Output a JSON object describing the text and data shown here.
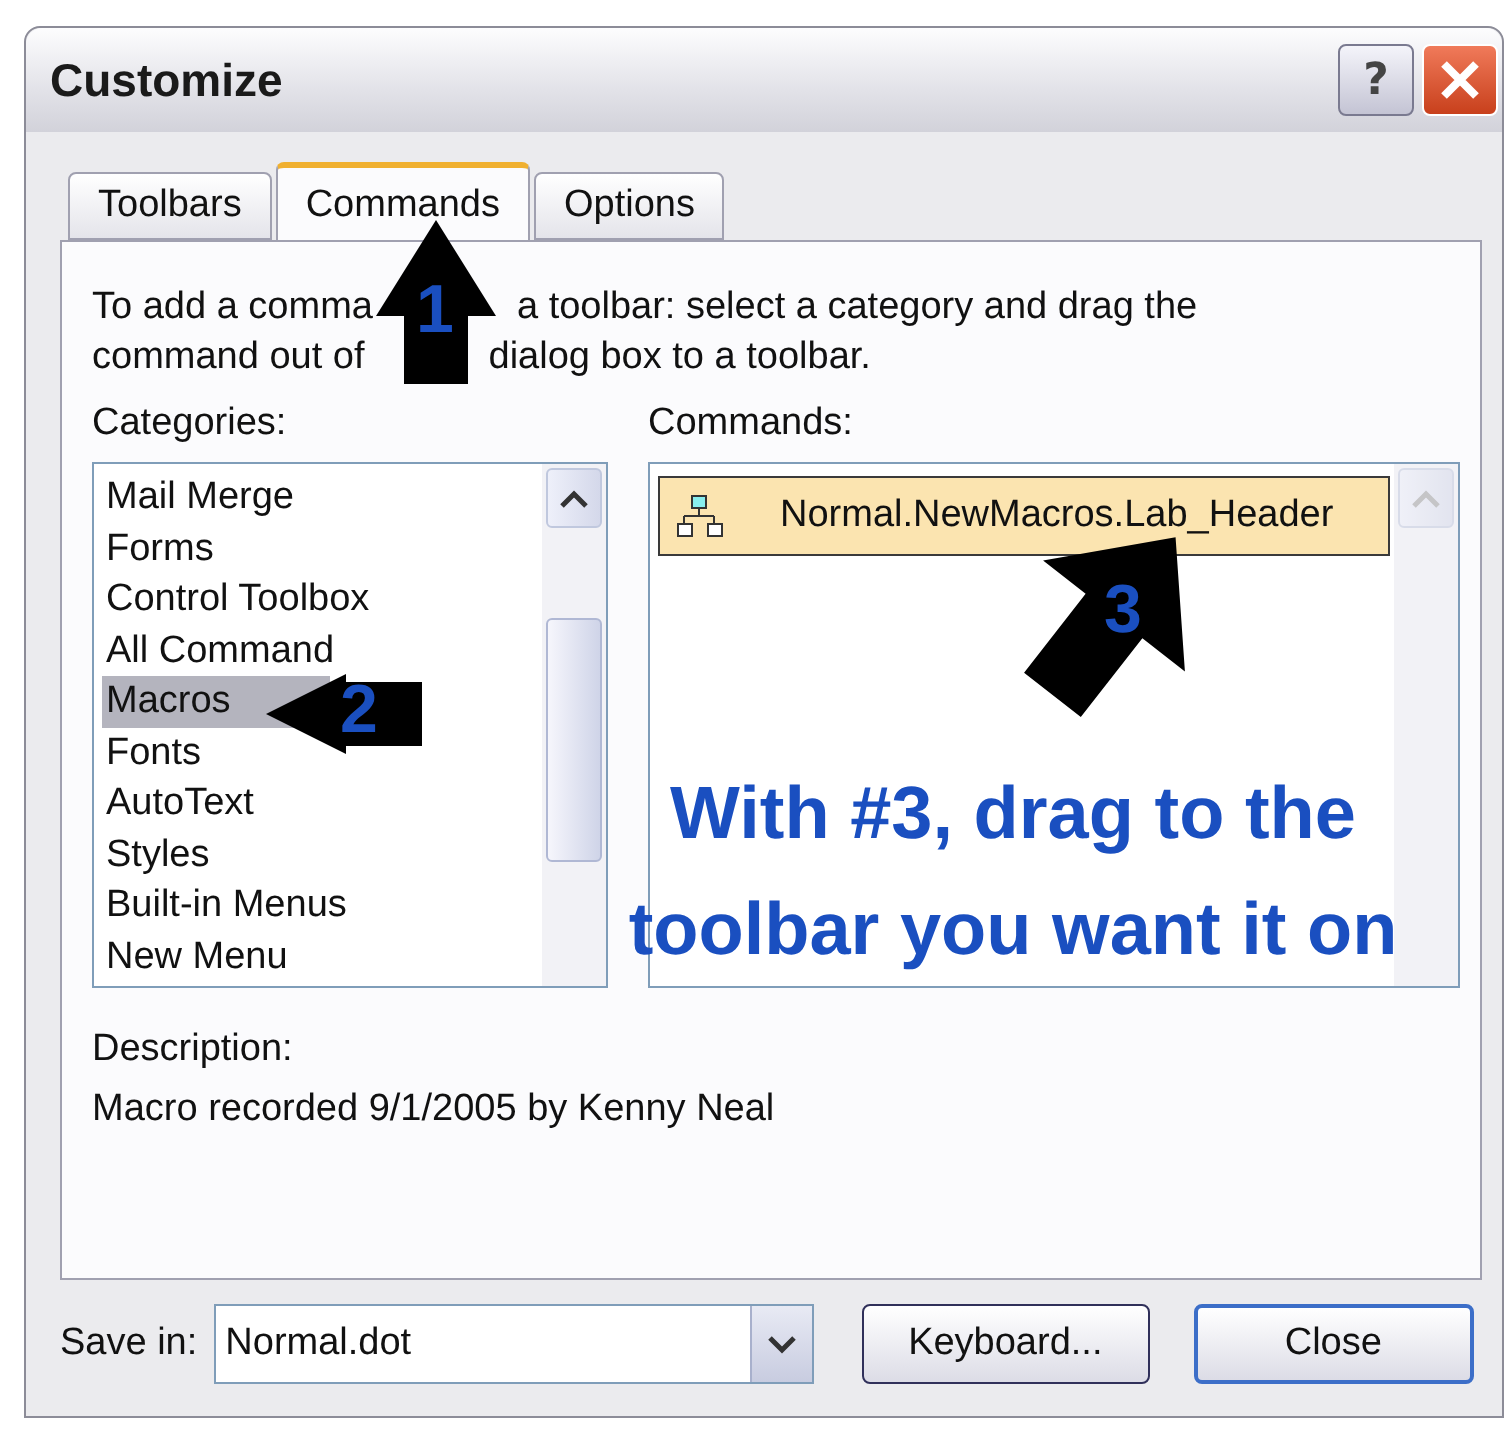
{
  "window": {
    "title": "Customize",
    "help_label": "?"
  },
  "tabs": [
    {
      "label": "Toolbars",
      "selected": false
    },
    {
      "label": "Commands",
      "selected": true
    },
    {
      "label": "Options",
      "selected": false
    }
  ],
  "instruction_lines": [
    [
      "To add a comma",
      "a toolbar: select a category and drag the"
    ],
    [
      "command out of",
      "dialog box to a toolbar."
    ]
  ],
  "categories": {
    "label": "Categories:",
    "items": [
      {
        "label": "Mail Merge",
        "selected": false
      },
      {
        "label": "Forms",
        "selected": false
      },
      {
        "label": "Control Toolbox",
        "selected": false
      },
      {
        "label": "All Command",
        "selected": false
      },
      {
        "label": "Macros",
        "selected": true
      },
      {
        "label": "Fonts",
        "selected": false
      },
      {
        "label": "AutoText",
        "selected": false
      },
      {
        "label": "Styles",
        "selected": false
      },
      {
        "label": "Built-in Menus",
        "selected": false
      },
      {
        "label": "New Menu",
        "selected": false
      }
    ]
  },
  "commands": {
    "label": "Commands:",
    "items": [
      {
        "label": "Normal.NewMacros.Lab_Header",
        "selected": true
      }
    ]
  },
  "description": {
    "label": "Description:",
    "text": "Macro recorded 9/1/2005 by Kenny Neal"
  },
  "save_in": {
    "label": "Save in:",
    "value": "Normal.dot"
  },
  "buttons": [
    {
      "label": "Keyboard...",
      "default": false
    },
    {
      "label": "Close",
      "default": true
    }
  ],
  "annotations": {
    "arrows": [
      {
        "number": "1"
      },
      {
        "number": "2"
      },
      {
        "number": "3"
      }
    ],
    "note_lines": [
      "With #3, drag to the",
      "toolbar you want it on"
    ]
  }
}
